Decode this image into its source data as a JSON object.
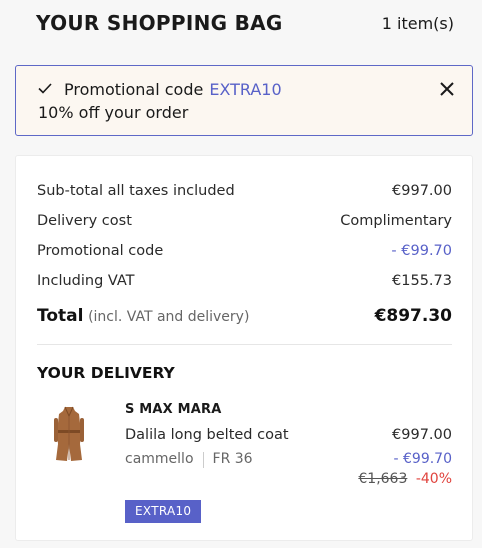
{
  "header": {
    "title": "YOUR SHOPPING BAG",
    "item_count": "1 item(s)"
  },
  "promo": {
    "applied_label": "Promotional code",
    "code": "EXTRA10",
    "description": "10% off your order",
    "check_icon": "check-icon",
    "close_icon": "close-icon"
  },
  "summary": {
    "rows": [
      {
        "label": "Sub-total all taxes included",
        "value": "€997.00"
      },
      {
        "label": "Delivery cost",
        "value": "Complimentary"
      },
      {
        "label": "Promotional code",
        "value": "- €99.70"
      },
      {
        "label": "Including VAT",
        "value": "€155.73"
      }
    ],
    "total_label": "Total",
    "total_note": "(incl. VAT and delivery)",
    "total_value": "€897.30"
  },
  "delivery": {
    "title": "YOUR DELIVERY",
    "item": {
      "brand": "S MAX MARA",
      "name": "Dalila long belted coat",
      "color": "cammello",
      "size": "FR 36",
      "price": "€997.00",
      "discount": "- €99.70",
      "original_price": "€1,663",
      "percent_off": "-40%",
      "promo_badge": "EXTRA10"
    }
  },
  "colors": {
    "accent": "#5861c8",
    "sale": "#e0433d",
    "promo_bg": "#fcf7f1"
  }
}
